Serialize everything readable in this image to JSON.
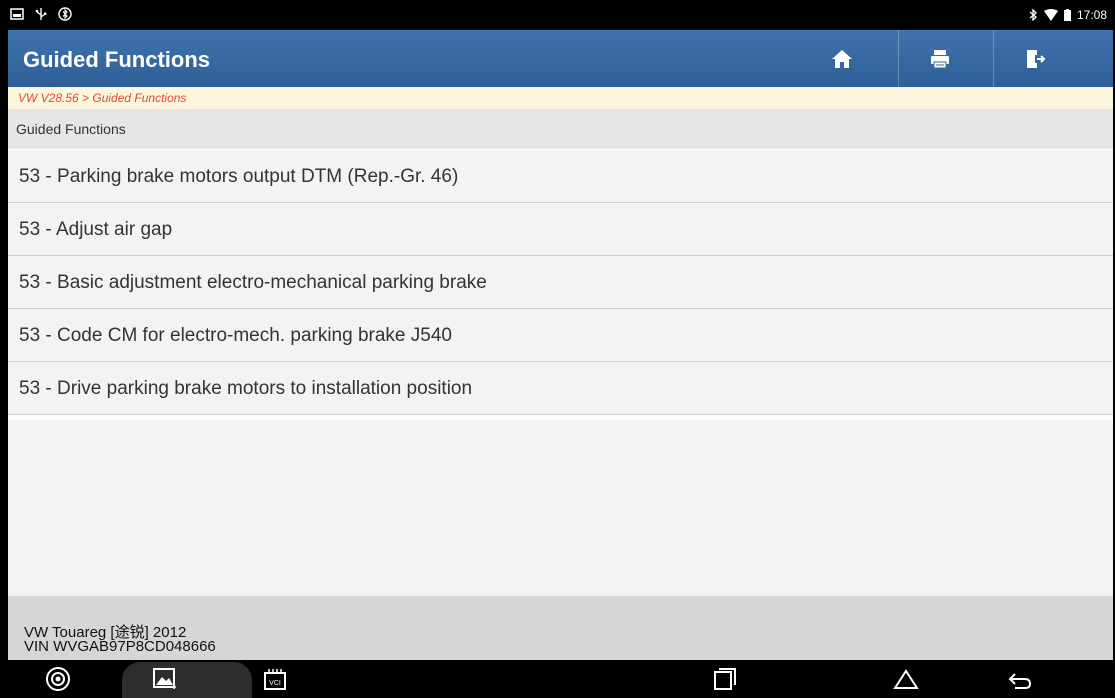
{
  "status_bar": {
    "time": "17:08",
    "left_icons": [
      "screenshot-icon",
      "usb-icon",
      "vci-bluetooth-icon"
    ],
    "right_icons": [
      "bluetooth-icon",
      "wifi-icon",
      "battery-icon"
    ]
  },
  "header": {
    "title": "Guided Functions",
    "buttons": [
      "home-icon",
      "print-icon",
      "exit-icon"
    ]
  },
  "breadcrumb": "VW V28.56 > Guided Functions",
  "section_title": "Guided Functions",
  "items": [
    "53 - Parking brake motors output DTM (Rep.-Gr. 46)",
    "53 - Adjust air gap",
    "53 - Basic adjustment electro-mechanical parking brake",
    "53 - Code CM for electro-mech. parking brake J540",
    "53 - Drive parking brake motors to installation position"
  ],
  "footer": {
    "vehicle": "VW Touareg [途锐] 2012",
    "vin": "VIN WVGAB97P8CD048666"
  },
  "nav_bar": {
    "left_icons": [
      "browser-icon",
      "gallery-icon",
      "vci-icon"
    ],
    "right_icons": [
      "recents-icon",
      "home-nav-icon",
      "back-icon"
    ]
  },
  "colors": {
    "header": "#3467a2",
    "breadcrumb_text": "#e0483b",
    "breadcrumb_bg": "#fdf6dc"
  }
}
